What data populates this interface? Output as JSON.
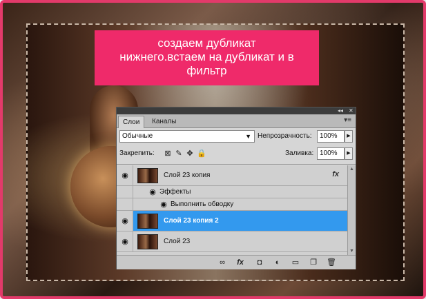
{
  "caption": {
    "line1": "создаем дубликат",
    "line2": "нижнего.встаем на дубликат и в",
    "line3": "фильтр"
  },
  "panel": {
    "tabs": [
      {
        "label": "Слои",
        "active": true
      },
      {
        "label": "Каналы",
        "active": false
      }
    ],
    "blend_mode": "Обычные",
    "opacity_label": "Непрозрачность:",
    "opacity_value": "100%",
    "lock_label": "Закрепить:",
    "fill_label": "Заливка:",
    "fill_value": "100%",
    "layers": [
      {
        "name": "Слой 23 копия",
        "visible": true,
        "has_fx": true,
        "selected": false
      },
      {
        "name": "Эффекты",
        "type": "effects-group",
        "visible": true
      },
      {
        "name": "Выполнить обводку",
        "type": "effect",
        "visible": true
      },
      {
        "name": "Слой 23 копия 2",
        "visible": true,
        "selected": true
      },
      {
        "name": "Слой 23",
        "visible": true,
        "selected": false
      }
    ],
    "fx_symbol": "fx",
    "accent_color": "#3399ee"
  },
  "frame_color": "#e23a6a",
  "caption_color": "#ef2a6a"
}
